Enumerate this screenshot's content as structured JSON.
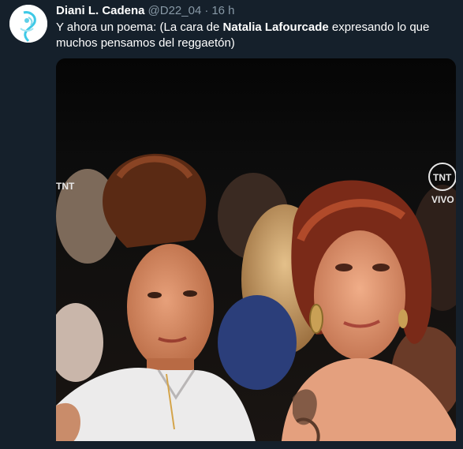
{
  "tweet": {
    "name": "Diani L. Cadena",
    "handle": "@D22_04",
    "separator": "·",
    "time": "16 h",
    "text_before": "Y ahora un poema: (La cara de ",
    "text_bold": "Natalia Lafourcade",
    "text_after": " expresando lo que muchos pensamos del reggaetón)"
  },
  "media": {
    "watermark_left": "TNT",
    "watermark_right_top": "TNT",
    "watermark_right_bottom": "VIVO"
  }
}
